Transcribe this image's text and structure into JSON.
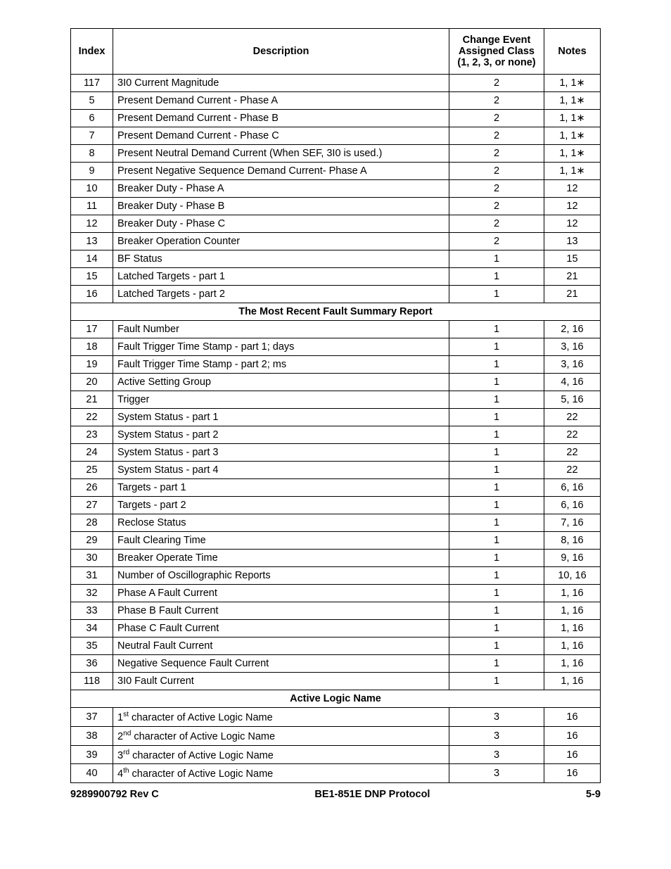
{
  "headers": {
    "index": "Index",
    "description": "Description",
    "class": "Change Event Assigned Class (1, 2, 3, or none)",
    "notes": "Notes"
  },
  "rows": [
    {
      "idx": "117",
      "desc": "3I0 Current Magnitude",
      "cls": "2",
      "notes": "1, 1∗"
    },
    {
      "idx": "5",
      "desc": "Present Demand Current - Phase A",
      "cls": "2",
      "notes": "1, 1∗"
    },
    {
      "idx": "6",
      "desc": "Present Demand Current - Phase B",
      "cls": "2",
      "notes": "1, 1∗"
    },
    {
      "idx": "7",
      "desc": "Present Demand Current - Phase C",
      "cls": "2",
      "notes": "1, 1∗"
    },
    {
      "idx": "8",
      "desc": "Present Neutral Demand Current (When SEF, 3I0 is used.)",
      "cls": "2",
      "notes": "1, 1∗"
    },
    {
      "idx": "9",
      "desc": "Present Negative Sequence Demand Current- Phase A",
      "cls": "2",
      "notes": "1, 1∗"
    },
    {
      "idx": "10",
      "desc": "Breaker Duty - Phase A",
      "cls": "2",
      "notes": "12"
    },
    {
      "idx": "11",
      "desc": "Breaker Duty - Phase B",
      "cls": "2",
      "notes": "12"
    },
    {
      "idx": "12",
      "desc": "Breaker Duty - Phase C",
      "cls": "2",
      "notes": "12"
    },
    {
      "idx": "13",
      "desc": "Breaker Operation Counter",
      "cls": "2",
      "notes": "13"
    },
    {
      "idx": "14",
      "desc": "BF Status",
      "cls": "1",
      "notes": "15"
    },
    {
      "idx": "15",
      "desc": "Latched Targets - part 1",
      "cls": "1",
      "notes": "21"
    },
    {
      "idx": "16",
      "desc": "Latched Targets - part 2",
      "cls": "1",
      "notes": "21"
    },
    {
      "section": "The Most Recent Fault Summary Report"
    },
    {
      "idx": "17",
      "desc": "Fault Number",
      "cls": "1",
      "notes": "2, 16"
    },
    {
      "idx": "18",
      "desc": "Fault Trigger Time Stamp - part 1; days",
      "cls": "1",
      "notes": "3, 16"
    },
    {
      "idx": "19",
      "desc": "Fault Trigger Time Stamp - part 2; ms",
      "cls": "1",
      "notes": "3, 16"
    },
    {
      "idx": "20",
      "desc": "Active Setting Group",
      "cls": "1",
      "notes": "4, 16"
    },
    {
      "idx": "21",
      "desc": "Trigger",
      "cls": "1",
      "notes": "5, 16"
    },
    {
      "idx": "22",
      "desc": "System Status - part 1",
      "cls": "1",
      "notes": "22"
    },
    {
      "idx": "23",
      "desc": "System Status - part 2",
      "cls": "1",
      "notes": "22"
    },
    {
      "idx": "24",
      "desc": "System Status - part 3",
      "cls": "1",
      "notes": "22"
    },
    {
      "idx": "25",
      "desc": "System Status - part 4",
      "cls": "1",
      "notes": "22"
    },
    {
      "idx": "26",
      "desc": "Targets - part 1",
      "cls": "1",
      "notes": "6, 16"
    },
    {
      "idx": "27",
      "desc": "Targets - part 2",
      "cls": "1",
      "notes": "6, 16"
    },
    {
      "idx": "28",
      "desc": "Reclose Status",
      "cls": "1",
      "notes": "7, 16"
    },
    {
      "idx": "29",
      "desc": "Fault Clearing Time",
      "cls": "1",
      "notes": "8, 16"
    },
    {
      "idx": "30",
      "desc": "Breaker Operate Time",
      "cls": "1",
      "notes": "9, 16"
    },
    {
      "idx": "31",
      "desc": "Number of Oscillographic Reports",
      "cls": "1",
      "notes": "10, 16"
    },
    {
      "idx": "32",
      "desc": "Phase A Fault Current",
      "cls": "1",
      "notes": "1, 16"
    },
    {
      "idx": "33",
      "desc": "Phase B Fault Current",
      "cls": "1",
      "notes": "1, 16"
    },
    {
      "idx": "34",
      "desc": "Phase C Fault Current",
      "cls": "1",
      "notes": "1, 16"
    },
    {
      "idx": "35",
      "desc": "Neutral Fault Current",
      "cls": "1",
      "notes": "1, 16"
    },
    {
      "idx": "36",
      "desc": "Negative Sequence Fault Current",
      "cls": "1",
      "notes": "1, 16"
    },
    {
      "idx": "118",
      "desc": "3I0 Fault Current",
      "cls": "1",
      "notes": "1, 16"
    },
    {
      "section": "Active Logic Name"
    },
    {
      "idx": "37",
      "desc_html": "1<sup>st</sup> character of Active Logic Name",
      "cls": "3",
      "notes": "16"
    },
    {
      "idx": "38",
      "desc_html": "2<sup>nd</sup> character of Active Logic Name",
      "cls": "3",
      "notes": "16"
    },
    {
      "idx": "39",
      "desc_html": "3<sup>rd</sup> character of Active Logic Name",
      "cls": "3",
      "notes": "16"
    },
    {
      "idx": "40",
      "desc_html": "4<sup>th</sup> character of Active Logic Name",
      "cls": "3",
      "notes": "16"
    }
  ],
  "footer": {
    "left": "9289900792 Rev C",
    "center": "BE1-851E DNP Protocol",
    "right": "5-9"
  }
}
